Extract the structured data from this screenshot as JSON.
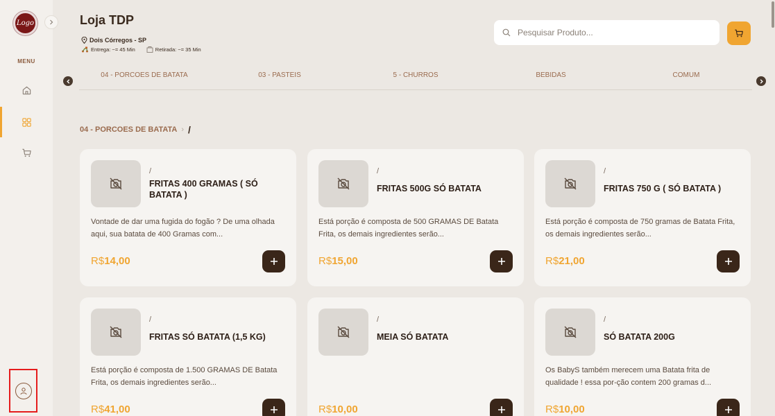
{
  "sidebar": {
    "logo_text": "Logo",
    "menu_label": "MENU",
    "items": [
      {
        "name": "home",
        "icon": "home-icon"
      },
      {
        "name": "catalog",
        "icon": "grid-icon",
        "active": true
      },
      {
        "name": "cart",
        "icon": "cart-icon"
      }
    ],
    "profile_icon": "user-icon"
  },
  "store": {
    "name": "Loja TDP",
    "location": "Dois Córregos - SP",
    "delivery": "Entrega: ~= 45 Min",
    "pickup": "Retirada: ~= 35 Min"
  },
  "search": {
    "placeholder": "Pesquisar Produto..."
  },
  "categories": [
    "04 - PORCOES DE BATATA",
    "03 - PASTEIS",
    "5 - CHURROS",
    "BEBIDAS",
    "COMUM"
  ],
  "breadcrumb": {
    "category": "04 - PORCOES DE BATATA",
    "current": "/"
  },
  "products": [
    {
      "prefix": "/",
      "name": "FRITAS 400 GRAMAS ( SÓ BATATA )",
      "description": "Vontade de dar uma fugida do fogão ? De uma olhada aqui, sua batata de 400 Gramas com...",
      "currency": "R$",
      "price": "14,00"
    },
    {
      "prefix": "/",
      "name": "FRITAS 500G SÓ BATATA",
      "description": "Está porção é composta de 500 GRAMAS DE Batata Frita, os demais ingredientes serão...",
      "currency": "R$",
      "price": "15,00"
    },
    {
      "prefix": "/",
      "name": "FRITAS 750 G ( SÓ BATATA )",
      "description": "Está porção é composta de 750 gramas de Batata Frita, os demais ingredientes serão...",
      "currency": "R$",
      "price": "21,00"
    },
    {
      "prefix": "/",
      "name": "FRITAS SÓ BATATA (1,5 KG)",
      "description": "Está porção é composta de 1.500 GRAMAS DE Batata Frita, os demais ingredientes serão...",
      "currency": "R$",
      "price": "41,00"
    },
    {
      "prefix": "/",
      "name": "MEIA SÓ BATATA",
      "description": "",
      "currency": "R$",
      "price": "10,00"
    },
    {
      "prefix": "/",
      "name": "SÓ BATATA 200G",
      "description": "Os BabyS também merecem uma Batata frita de qualidade ! essa por-ção contem 200 gramas d...",
      "currency": "R$",
      "price": "10,00"
    }
  ],
  "colors": {
    "accent": "#f0a531",
    "dark": "#3a2619",
    "brand": "#7a1717",
    "highlight": "#e51c1c"
  }
}
